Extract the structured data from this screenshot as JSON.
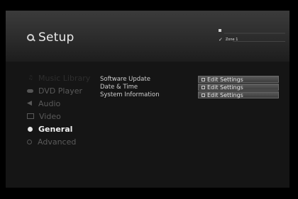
{
  "header": {
    "title": "Setup",
    "title_icon": "search-icon",
    "zone_label": "Zone 1"
  },
  "sidebar": {
    "items": [
      {
        "label": "Music Library",
        "icon": "music-icon",
        "state": "faded"
      },
      {
        "label": "DVD Player",
        "icon": "disc-icon",
        "state": "normal"
      },
      {
        "label": "Audio",
        "icon": "speaker-icon",
        "state": "normal"
      },
      {
        "label": "Video",
        "icon": "monitor-icon",
        "state": "normal"
      },
      {
        "label": "General",
        "icon": "dot-icon",
        "state": "active"
      },
      {
        "label": "Advanced",
        "icon": "magnifier-icon",
        "state": "normal"
      }
    ]
  },
  "settings": {
    "rows": [
      {
        "label": "Software Update",
        "button": "Edit Settings"
      },
      {
        "label": "Date & Time",
        "button": "Edit Settings"
      },
      {
        "label": "System Information",
        "button": "Edit Settings"
      }
    ]
  },
  "colors": {
    "background": "#000000",
    "header": "#333333",
    "content": "#151515",
    "active_text": "#f2f2f2",
    "inactive_text": "#5a5a5a"
  }
}
